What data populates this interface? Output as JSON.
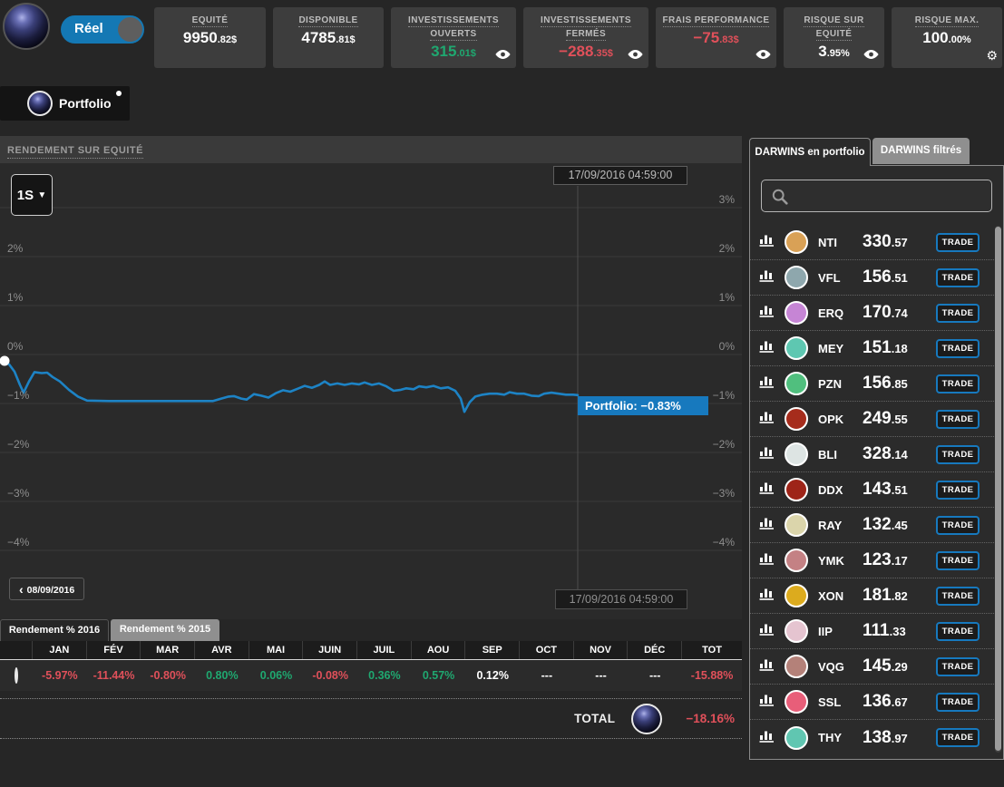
{
  "header": {
    "toggle_label": "Réel",
    "stats": [
      {
        "name": "equity",
        "label": "EQUITÉ",
        "value": "9950.82$",
        "color": "white",
        "icon": null
      },
      {
        "name": "available",
        "label": "DISPONIBLE",
        "value": "4785.81$",
        "color": "white",
        "icon": null
      },
      {
        "name": "open-investments",
        "label": "INVESTISSEMENTS OUVERTS",
        "value": "315.01$",
        "color": "green",
        "icon": "eye"
      },
      {
        "name": "closed-investments",
        "label": "INVESTISSEMENTS FERMÉS",
        "value": "−288.35$",
        "color": "red",
        "icon": "eye"
      },
      {
        "name": "performance-fees",
        "label": "FRAIS PERFORMANCE",
        "value": "−75.83$",
        "color": "red",
        "icon": "eye"
      },
      {
        "name": "risk-on-equity",
        "label": "RISQUE SUR EQUITÉ",
        "value": "3.95%",
        "color": "white",
        "icon": "eye"
      },
      {
        "name": "max-risk",
        "label": "RISQUE MAX.",
        "value": "100.00%",
        "color": "white",
        "icon": "gear"
      }
    ]
  },
  "portfolio_tab": {
    "label": "Portfolio"
  },
  "chart": {
    "title": "RENDEMENT SUR EQUITÉ",
    "range_selector": "1S",
    "crosshair_date": "17/09/2016 04:59:00",
    "nav_back_date": "08/09/2016",
    "tooltip_label": "Portfolio: −0.83%"
  },
  "chart_data": {
    "type": "line",
    "title": "Rendement sur equité (1 semaine)",
    "ylim": [
      -4.5,
      3.5
    ],
    "grid": true,
    "crosshair_x": 637,
    "crosshair_date": "17/09/2016 04:59:00",
    "last_value_pct": -0.83,
    "y_gridlines_pct": [
      3,
      2,
      1,
      0,
      -1,
      -2,
      -3,
      -4
    ],
    "left_axis": [
      {
        "p": 2,
        "t": "2%"
      },
      {
        "p": 1,
        "t": "1%"
      },
      {
        "p": 0,
        "t": "0%"
      },
      {
        "p": -1,
        "t": "−1%"
      },
      {
        "p": -2,
        "t": "−2%"
      },
      {
        "p": -3,
        "t": "−3%"
      },
      {
        "p": -4,
        "t": "−4%"
      }
    ],
    "right_axis": [
      {
        "p": 3,
        "t": "3%"
      },
      {
        "p": 2,
        "t": "2%"
      },
      {
        "p": 1,
        "t": "1%"
      },
      {
        "p": 0,
        "t": "0%"
      },
      {
        "p": -1,
        "t": "−1%"
      },
      {
        "p": -2,
        "t": "−2%"
      },
      {
        "p": -3,
        "t": "−3%"
      },
      {
        "p": -4,
        "t": "−4%"
      }
    ],
    "series": [
      {
        "name": "Portfolio",
        "color": "#1d83c5",
        "points": [
          [
            2,
            -0.13
          ],
          [
            10,
            -0.2
          ],
          [
            16,
            -0.35
          ],
          [
            22,
            -0.62
          ],
          [
            26,
            -0.78
          ],
          [
            32,
            -0.55
          ],
          [
            38,
            -0.36
          ],
          [
            46,
            -0.38
          ],
          [
            52,
            -0.37
          ],
          [
            58,
            -0.46
          ],
          [
            66,
            -0.55
          ],
          [
            76,
            -0.72
          ],
          [
            86,
            -0.86
          ],
          [
            96,
            -0.94
          ],
          [
            120,
            -0.95
          ],
          [
            160,
            -0.95
          ],
          [
            200,
            -0.95
          ],
          [
            235,
            -0.95
          ],
          [
            244,
            -0.9
          ],
          [
            252,
            -0.86
          ],
          [
            258,
            -0.85
          ],
          [
            266,
            -0.9
          ],
          [
            272,
            -0.92
          ],
          [
            280,
            -0.81
          ],
          [
            288,
            -0.84
          ],
          [
            296,
            -0.88
          ],
          [
            304,
            -0.79
          ],
          [
            312,
            -0.73
          ],
          [
            320,
            -0.76
          ],
          [
            328,
            -0.7
          ],
          [
            336,
            -0.64
          ],
          [
            344,
            -0.68
          ],
          [
            352,
            -0.62
          ],
          [
            358,
            -0.55
          ],
          [
            364,
            -0.62
          ],
          [
            372,
            -0.59
          ],
          [
            380,
            -0.62
          ],
          [
            388,
            -0.59
          ],
          [
            396,
            -0.61
          ],
          [
            402,
            -0.57
          ],
          [
            410,
            -0.62
          ],
          [
            418,
            -0.59
          ],
          [
            426,
            -0.65
          ],
          [
            434,
            -0.74
          ],
          [
            442,
            -0.72
          ],
          [
            448,
            -0.69
          ],
          [
            456,
            -0.71
          ],
          [
            462,
            -0.65
          ],
          [
            470,
            -0.67
          ],
          [
            478,
            -0.64
          ],
          [
            486,
            -0.69
          ],
          [
            494,
            -0.67
          ],
          [
            502,
            -0.74
          ],
          [
            508,
            -0.9
          ],
          [
            512,
            -1.17
          ],
          [
            518,
            -0.97
          ],
          [
            524,
            -0.86
          ],
          [
            532,
            -0.82
          ],
          [
            540,
            -0.8
          ],
          [
            548,
            -0.8
          ],
          [
            556,
            -0.82
          ],
          [
            562,
            -0.77
          ],
          [
            570,
            -0.8
          ],
          [
            578,
            -0.8
          ],
          [
            586,
            -0.84
          ],
          [
            594,
            -0.85
          ],
          [
            600,
            -0.8
          ],
          [
            608,
            -0.78
          ],
          [
            616,
            -0.8
          ],
          [
            624,
            -0.82
          ],
          [
            632,
            -0.82
          ],
          [
            637,
            -0.83
          ]
        ]
      }
    ]
  },
  "returns_table": {
    "tabs": [
      "Rendement % 2016",
      "Rendement % 2015"
    ],
    "active_tab": 0,
    "columns": [
      "JAN",
      "FÉV",
      "MAR",
      "AVR",
      "MAI",
      "JUIN",
      "JUIL",
      "AOU",
      "SEP",
      "OCT",
      "NOV",
      "DÉC",
      "TOT"
    ],
    "values": [
      "-5.97%",
      "-11.44%",
      "-0.80%",
      "0.80%",
      "0.06%",
      "-0.08%",
      "0.36%",
      "0.57%",
      "0.12%",
      "---",
      "---",
      "---",
      "-15.88%"
    ],
    "value_colors": [
      "red",
      "red",
      "red",
      "green",
      "green",
      "red",
      "green",
      "green",
      "white",
      "white",
      "white",
      "white",
      "red"
    ],
    "total_label": "TOTAL",
    "total_value": "−18.16%"
  },
  "sidebar": {
    "tabs": [
      "DARWINS en portfolio",
      "DARWINS filtrés"
    ],
    "active_tab": 0,
    "search_placeholder": "",
    "trade_label": "TRADE",
    "darwins": [
      {
        "ticker": "NTI",
        "price": "330.57",
        "color": "#d9a156"
      },
      {
        "ticker": "VFL",
        "price": "156.51",
        "color": "#8ea7ad"
      },
      {
        "ticker": "ERQ",
        "price": "170.74",
        "color": "#c685d5"
      },
      {
        "ticker": "MEY",
        "price": "151.18",
        "color": "#5ec7b1"
      },
      {
        "ticker": "PZN",
        "price": "156.85",
        "color": "#50bf7e"
      },
      {
        "ticker": "OPK",
        "price": "249.55",
        "color": "#a62c1c"
      },
      {
        "ticker": "BLI",
        "price": "328.14",
        "color": "#dde4e3"
      },
      {
        "ticker": "DDX",
        "price": "143.51",
        "color": "#9e2418"
      },
      {
        "ticker": "RAY",
        "price": "132.45",
        "color": "#dbd5ab"
      },
      {
        "ticker": "YMK",
        "price": "123.17",
        "color": "#c48184"
      },
      {
        "ticker": "XON",
        "price": "181.82",
        "color": "#dcab1e"
      },
      {
        "ticker": "IIP",
        "price": "111.33",
        "color": "#e5c4d0"
      },
      {
        "ticker": "VQG",
        "price": "145.29",
        "color": "#b48179"
      },
      {
        "ticker": "SSL",
        "price": "136.67",
        "color": "#e85e79"
      },
      {
        "ticker": "THY",
        "price": "138.97",
        "color": "#60c6b1"
      }
    ]
  },
  "colors": {
    "accent_blue": "#1779be",
    "positive_green": "#1fa870",
    "negative_red": "#e0505a",
    "chart_line": "#1d83c5"
  }
}
